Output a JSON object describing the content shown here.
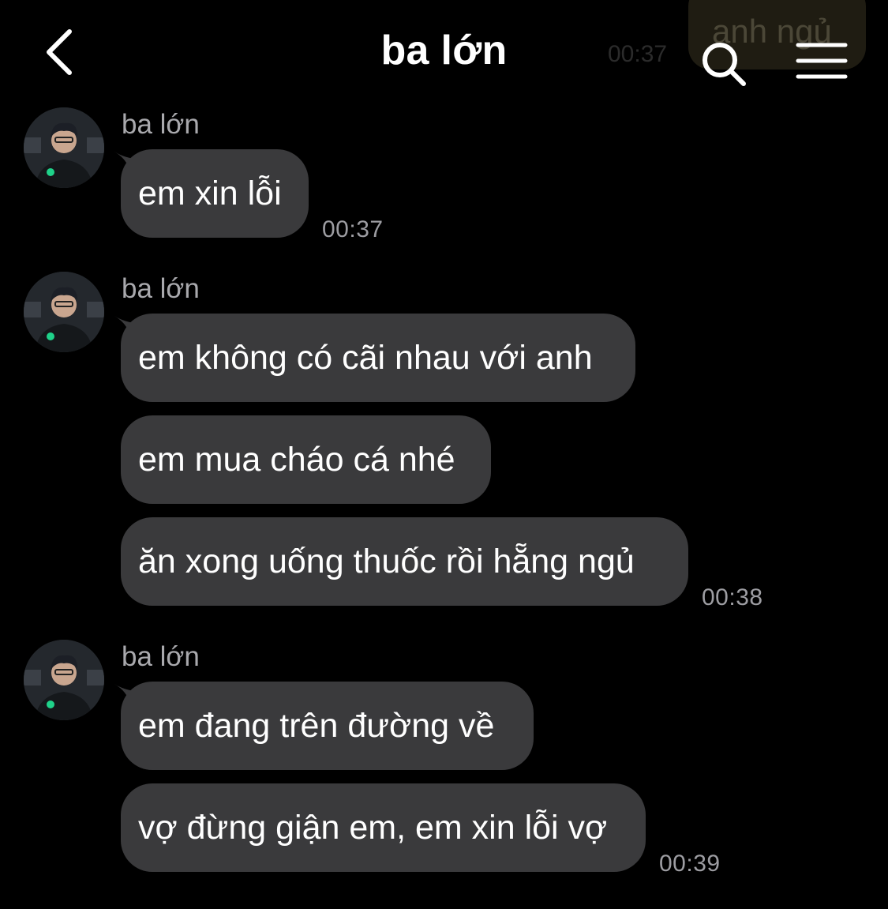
{
  "header": {
    "title": "ba lớn",
    "back_icon": "chevron-left-icon",
    "search_icon": "search-icon",
    "menu_icon": "menu-icon"
  },
  "peek_message": {
    "text": "anh ngủ",
    "time": "00:37"
  },
  "groups": [
    {
      "sender": "ba lớn",
      "messages": [
        "em xin lỗi"
      ],
      "time": "00:37"
    },
    {
      "sender": "ba lớn",
      "messages": [
        "em không có cãi nhau với anh",
        "em mua cháo cá nhé",
        "ăn xong uống thuốc rồi hẵng ngủ"
      ],
      "time": "00:38"
    },
    {
      "sender": "ba lớn",
      "messages": [
        "em đang trên đường về",
        "vợ đừng giận em, em xin lỗi vợ"
      ],
      "time": "00:39"
    }
  ],
  "colors": {
    "background": "#000000",
    "bubble": "#3a3a3c",
    "secondary_text": "#9d9da2"
  }
}
